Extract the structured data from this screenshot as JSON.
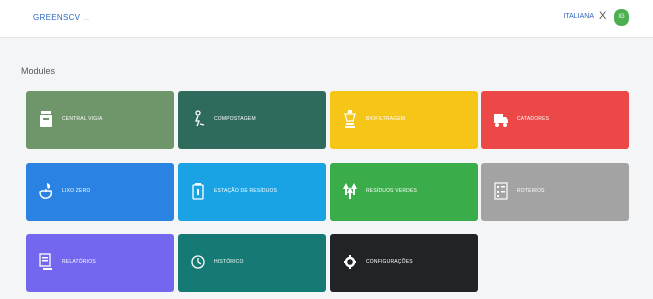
{
  "header": {
    "brand": "GREENSCV",
    "brand_sub": "...",
    "user_name": "ITALIANA",
    "separator": "|",
    "close_symbol": "X",
    "avatar_initials": "IG"
  },
  "main": {
    "section_title": "Modules"
  },
  "modules": [
    {
      "label": "CENTRAL VIGIA",
      "color": "#6f966a",
      "icon": "trash-bin-icon"
    },
    {
      "label": "COMPOSTAGEM",
      "color": "#2f6b5c",
      "icon": "recycle-person-icon"
    },
    {
      "label": "BIOFILTRAGEM",
      "color": "#f5c518",
      "icon": "filter-tower-icon"
    },
    {
      "label": "CATADORES",
      "color": "#ec4848",
      "icon": "truck-icon"
    },
    {
      "label": "LIXO ZERO",
      "color": "#2a83e3",
      "icon": "hand-leaf-icon"
    },
    {
      "label": "ESTAÇÃO DE RESÍDUOS",
      "color": "#1aa3e4",
      "icon": "bin-station-icon"
    },
    {
      "label": "RESÍDUOS VERDES",
      "color": "#3aad4a",
      "icon": "trees-icon"
    },
    {
      "label": "ROTEIROS",
      "color": "#a3a3a3",
      "icon": "checklist-icon"
    },
    {
      "label": "RELATÓRIOS",
      "color": "#7367ef",
      "icon": "report-hand-icon"
    },
    {
      "label": "HISTÓRICO",
      "color": "#167a74",
      "icon": "history-icon"
    },
    {
      "label": "CONFIGURAÇÕES",
      "color": "#202427",
      "icon": "gear-icon"
    }
  ]
}
